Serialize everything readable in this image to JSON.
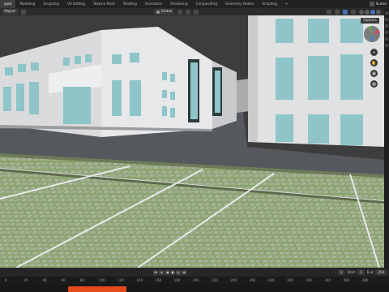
{
  "workspace_tabs": [
    "yout",
    "Modeling",
    "Sculpting",
    "UV Editing",
    "Texture Paint",
    "Shading",
    "Animation",
    "Rendering",
    "Compositing",
    "Geometry Nodes",
    "Scripting",
    "+"
  ],
  "active_tab_index": 0,
  "scene": {
    "name": "Scene"
  },
  "header": {
    "mode": "Object",
    "orientation": "Global"
  },
  "viewport": {
    "options_label": "Options"
  },
  "timeline": {
    "left_label": "",
    "start_label": "Start",
    "start_value": "1",
    "end_label": "End",
    "end_value": "250",
    "current_frame": "1"
  },
  "ruler_ticks": [
    "0",
    "20",
    "40",
    "60",
    "80",
    "100",
    "120",
    "140",
    "160",
    "180",
    "200",
    "220",
    "240",
    "260",
    "280",
    "300",
    "320",
    "340",
    "360",
    "380"
  ],
  "colors": {
    "accent": "#4772b3",
    "sky": "#3d3d3d",
    "building": "#e1e3e4",
    "window": "#8fc5c8",
    "grass": "#7e9a62",
    "road": "#53565a"
  }
}
